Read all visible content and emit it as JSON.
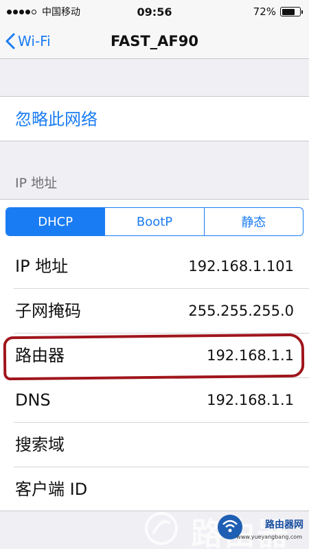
{
  "status_bar": {
    "carrier": "中国移动",
    "time": "09:56",
    "battery_percent": "72%",
    "battery_level": 0.72,
    "signal_bars_filled": 4,
    "signal_bars_total": 5
  },
  "nav": {
    "back_label": "Wi-Fi",
    "title": "FAST_AF90"
  },
  "forget_network": "忽略此网络",
  "ip_section": {
    "header": "IP 地址",
    "segments": [
      {
        "label": "DHCP",
        "selected": true
      },
      {
        "label": "BootP",
        "selected": false
      },
      {
        "label": "静态",
        "selected": false
      }
    ],
    "rows": [
      {
        "label": "IP 地址",
        "value": "192.168.1.101"
      },
      {
        "label": "子网掩码",
        "value": "255.255.255.0"
      },
      {
        "label": "路由器",
        "value": "192.168.1.1"
      },
      {
        "label": "DNS",
        "value": "192.168.1.1"
      },
      {
        "label": "搜索域",
        "value": ""
      },
      {
        "label": "客户端 ID",
        "value": ""
      }
    ]
  },
  "watermark": {
    "brand": "路由器网",
    "url": "www.yueyangbang.com",
    "big_text": "路由器"
  },
  "colors": {
    "accent": "#1a7cf2",
    "highlight": "#a0151c",
    "background": "#efeff4"
  }
}
